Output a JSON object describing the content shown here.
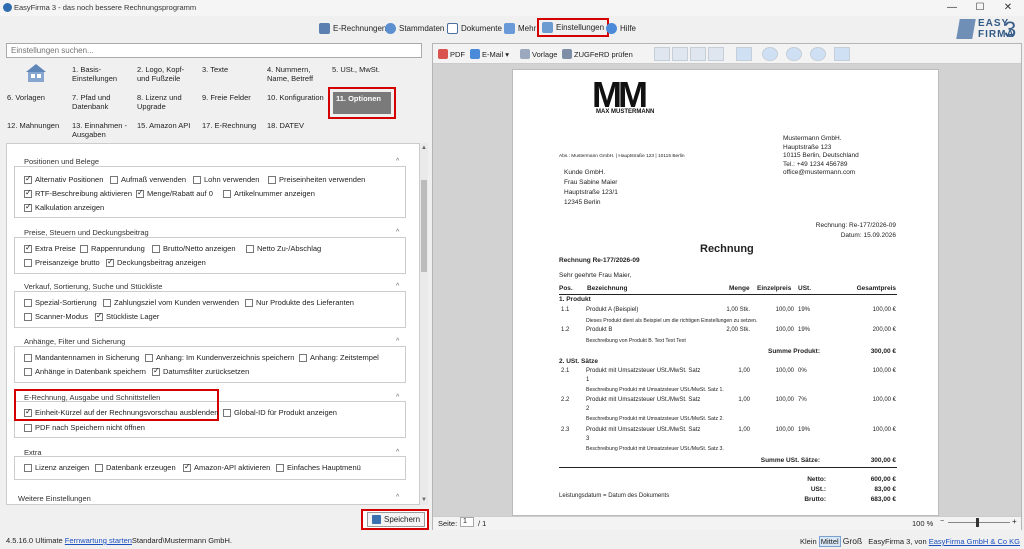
{
  "window": {
    "title": "EasyFirma 3 - das noch bessere Rechnungsprogramm",
    "controls": [
      "—",
      "☐",
      "✕"
    ]
  },
  "menu": [
    {
      "label": "E-Rechnungen",
      "color": "#5a7fb0"
    },
    {
      "label": "Stammdaten",
      "color": "#5b8fd0"
    },
    {
      "label": "Dokumente",
      "color": "#4a6fa0"
    },
    {
      "label": "Mehr",
      "color": "#6a9ad8"
    },
    {
      "label": "Einstellungen",
      "color": "#6c9bd1"
    },
    {
      "label": "Hilfe",
      "color": "#4a8ad8"
    }
  ],
  "logo": {
    "line1": "EASY",
    "line2": "FIRMA",
    "num": "3"
  },
  "search": {
    "placeholder": "Einstellungen suchen..."
  },
  "categories": [
    "1. Basis-\nEinstellungen",
    "2. Logo, Kopf-\nund Fußzeile",
    "3. Texte",
    "4. Nummern,\nName, Betreff",
    "5. USt., MwSt.",
    "6. Vorlagen",
    "7. Pfad und\nDatenbank",
    "8. Lizenz und\nUpgrade",
    "9. Freie Felder",
    "10. Konfiguration",
    "11. Optionen",
    "12. Mahnungen",
    "13. Einnahmen -\nAusgaben",
    "15. Amazon API",
    "17. E-Rechnung",
    "18. DATEV"
  ],
  "groups": {
    "positions": {
      "title": "Positionen und Belege",
      "rows": [
        [
          {
            "label": "Alternativ Positionen",
            "checked": true
          },
          {
            "label": "Aufmaß verwenden",
            "checked": false
          },
          {
            "label": "Lohn verwenden",
            "checked": false
          },
          {
            "label": "Preiseinheiten verwenden",
            "checked": false
          }
        ],
        [
          {
            "label": "RTF-Beschreibung aktivieren",
            "checked": true
          },
          {
            "label": "Menge/Rabatt auf 0",
            "checked": true
          },
          {
            "label": "Artikelnummer anzeigen",
            "checked": false
          }
        ],
        [
          {
            "label": "Kalkulation anzeigen",
            "checked": true
          }
        ]
      ]
    },
    "prices": {
      "title": "Preise, Steuern und Deckungsbeitrag",
      "rows": [
        [
          {
            "label": "Extra Preise",
            "checked": true
          },
          {
            "label": "Rappenrundung",
            "checked": false
          },
          {
            "label": "Brutto/Netto anzeigen",
            "checked": false
          },
          {
            "label": "Netto Zu-/Abschlag",
            "checked": false
          }
        ],
        [
          {
            "label": "Preisanzeige brutto",
            "checked": false
          },
          {
            "label": "Deckungsbeitrag anzeigen",
            "checked": true
          }
        ]
      ]
    },
    "sales": {
      "title": "Verkauf, Sortierung, Suche und Stückliste",
      "rows": [
        [
          {
            "label": "Spezial-Sortierung",
            "checked": false
          },
          {
            "label": "Zahlungsziel vom Kunden verwenden",
            "checked": false
          },
          {
            "label": "Nur Produkte des Lieferanten",
            "checked": false
          }
        ],
        [
          {
            "label": "Scanner-Modus",
            "checked": false
          },
          {
            "label": "Stückliste Lager",
            "checked": true
          }
        ]
      ]
    },
    "attachments": {
      "title": "Anhänge, Filter und Sicherung",
      "rows": [
        [
          {
            "label": "Mandantennamen in Sicherung",
            "checked": false
          },
          {
            "label": "Anhang: Im Kundenverzeichnis speichern",
            "checked": false
          },
          {
            "label": "Anhang: Zeitstempel",
            "checked": false
          }
        ],
        [
          {
            "label": "Anhänge in Datenbank speichern",
            "checked": false
          },
          {
            "label": "Datumsfilter zurücksetzen",
            "checked": true
          }
        ]
      ]
    },
    "erechnung": {
      "title": "E-Rechnung, Ausgabe und Schnittstellen",
      "rows": [
        [
          {
            "label": "Einheit-Kürzel auf der Rechnungsvorschau ausblenden",
            "checked": true
          },
          {
            "label": "Global-ID für Produkt anzeigen",
            "checked": false
          }
        ],
        [
          {
            "label": "PDF nach Speichern nicht öffnen",
            "checked": false
          }
        ]
      ]
    },
    "extra": {
      "title": "Extra",
      "rows": [
        [
          {
            "label": "Lizenz anzeigen",
            "checked": false
          },
          {
            "label": "Datenbank erzeugen",
            "checked": false
          },
          {
            "label": "Amazon-API aktivieren",
            "checked": true
          },
          {
            "label": "Einfaches Hauptmenü",
            "checked": false
          }
        ]
      ]
    },
    "more": {
      "title": "Weitere Einstellungen"
    }
  },
  "save_button": "Speichern",
  "status": {
    "version": "4.5.16.0 Ultimate",
    "link": "Fernwartung starten",
    "rest": "Standard\\Mustermann GmbH."
  },
  "status_right": {
    "small": "Klein",
    "medium": "Mittel",
    "large": "Groß",
    "brand": "EasyFirma 3, von",
    "link": "EasyFirma GmbH & Co KG"
  },
  "preview_toolbar": {
    "pdf": "PDF",
    "email": "E-Mail",
    "template": "Vorlage",
    "zugferd": "ZUGFeRD prüfen"
  },
  "preview_footer": {
    "page_label": "Seite:",
    "page": "1",
    "of": "/ 1",
    "zoom": "100 %"
  },
  "invoice": {
    "logo_letters": "MM",
    "logo_caption": "MAX MUSTERMANN",
    "sender_line": "Abs.: Mustermann GmbH. | Hauptstraße 123 | 10115 Berlin",
    "company": [
      "Mustermann GmbH.",
      "Hauptstraße 123",
      "10115 Berlin, Deutschland",
      "Tel.: +49 1234 456789",
      "office@mustermann.com"
    ],
    "recipient": [
      "Kunde GmbH.",
      "Frau Sabine Maier",
      "Hauptstraße 123/1",
      "12345 Berlin"
    ],
    "invoice_no": "Rechnung: Re-177/2026-09",
    "date": "Datum: 15.09.2026",
    "heading": "Rechnung",
    "subject": "Rechnung Re-177/2026-09",
    "greeting": "Sehr geehrte Frau Maier,",
    "columns": [
      "Pos.",
      "Bezeichnung",
      "Menge",
      "Einzelpreis",
      "USt.",
      "Gesamtpreis"
    ],
    "section1": "1. Produkt",
    "items1": [
      {
        "pos": "1.1",
        "name": "Produkt A (Beispiel)",
        "qty": "1,00 Stk.",
        "price": "100,00",
        "vat": "19%",
        "total": "100,00 €",
        "desc": "Dieses Produkt dient als Beispiel um die richtigen Einstellungen zu setzen."
      },
      {
        "pos": "1.2",
        "name": "Produkt B",
        "qty": "2,00 Stk.",
        "price": "100,00",
        "vat": "19%",
        "total": "200,00 €",
        "desc": "Beschreibung von Produkt B. Text Text Text"
      }
    ],
    "sum1_label": "Summe Produkt:",
    "sum1": "300,00 €",
    "section2": "2. USt. Sätze",
    "items2": [
      {
        "pos": "2.1",
        "name": "Produkt mit Umsatzsteuer USt./MwSt. Satz",
        "name2": "1",
        "qty": "1,00",
        "price": "100,00",
        "vat": "0%",
        "total": "100,00 €",
        "desc": "Beschreibung Produkt mit Umsatzsteuer USt./MwSt. Satz 1."
      },
      {
        "pos": "2.2",
        "name": "Produkt mit Umsatzsteuer USt./MwSt. Satz",
        "name2": "2",
        "qty": "1,00",
        "price": "100,00",
        "vat": "7%",
        "total": "100,00 €",
        "desc": "Beschreibung Produkt mit Umsatzsteuer USt./MwSt. Satz 2."
      },
      {
        "pos": "2.3",
        "name": "Produkt mit Umsatzsteuer USt./MwSt. Satz",
        "name2": "3",
        "qty": "1,00",
        "price": "100,00",
        "vat": "19%",
        "total": "100,00 €",
        "desc": "Beschreibung Produkt mit Umsatzsteuer USt./MwSt. Satz 3."
      }
    ],
    "sum2_label": "Summe USt. Sätze:",
    "sum2": "300,00 €",
    "service_date": "Leistungsdatum = Datum des Dokuments",
    "totals": [
      {
        "label": "Netto:",
        "value": "600,00 €"
      },
      {
        "label": "USt.:",
        "value": "83,00 €"
      },
      {
        "label": "Brutto:",
        "value": "683,00 €"
      }
    ]
  }
}
